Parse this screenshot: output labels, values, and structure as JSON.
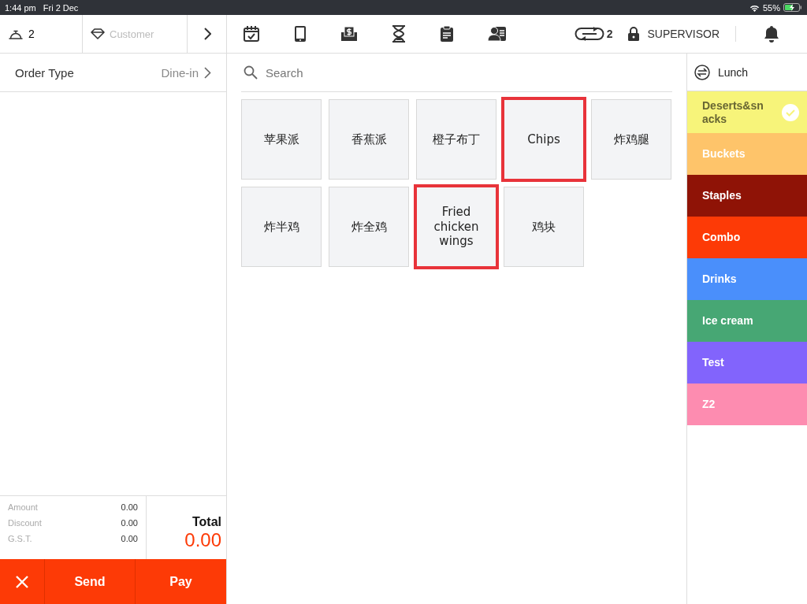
{
  "status_bar": {
    "time": "1:44 pm",
    "date": "Fri 2 Dec",
    "battery": "55%"
  },
  "top_bar": {
    "guests": "2",
    "customer": {
      "placeholder": "Customer"
    },
    "desc_count": "2",
    "role": "SUPERVISOR"
  },
  "order": {
    "label": "Order Type",
    "value": "Dine-in"
  },
  "summary": {
    "rows": [
      {
        "label": "Amount",
        "value": "0.00"
      },
      {
        "label": "Discount",
        "value": "0.00"
      },
      {
        "label": "G.S.T.",
        "value": "0.00"
      }
    ],
    "total_label": "Total",
    "total": "0.00"
  },
  "actions": {
    "send": "Send",
    "pay": "Pay"
  },
  "search": {
    "placeholder": "Search"
  },
  "products": [
    {
      "name": "苹果派",
      "highlighted": false
    },
    {
      "name": "香蕉派",
      "highlighted": false
    },
    {
      "name": "橙子布丁",
      "highlighted": false
    },
    {
      "name": "Chips",
      "highlighted": true
    },
    {
      "name": "炸鸡腿",
      "highlighted": false
    },
    {
      "name": "炸半鸡",
      "highlighted": false
    },
    {
      "name": "炸全鸡",
      "highlighted": false
    },
    {
      "name": "Fried chicken wings",
      "highlighted": true
    },
    {
      "name": "鸡块",
      "highlighted": false
    }
  ],
  "menu": {
    "name": "Lunch"
  },
  "categories": [
    {
      "name": "Deserts&snacks",
      "color": "#f7f47a",
      "selected": true
    },
    {
      "name": "Buckets",
      "color": "#fec46a",
      "selected": false
    },
    {
      "name": "Staples",
      "color": "#8f1306",
      "selected": false
    },
    {
      "name": "Combo",
      "color": "#fd3a06",
      "selected": false
    },
    {
      "name": "Drinks",
      "color": "#4a8ffb",
      "selected": false
    },
    {
      "name": "Ice cream",
      "color": "#47a774",
      "selected": false
    },
    {
      "name": "Test",
      "color": "#8264fc",
      "selected": false
    },
    {
      "name": "Z2",
      "color": "#fd8cb0",
      "selected": false
    }
  ]
}
